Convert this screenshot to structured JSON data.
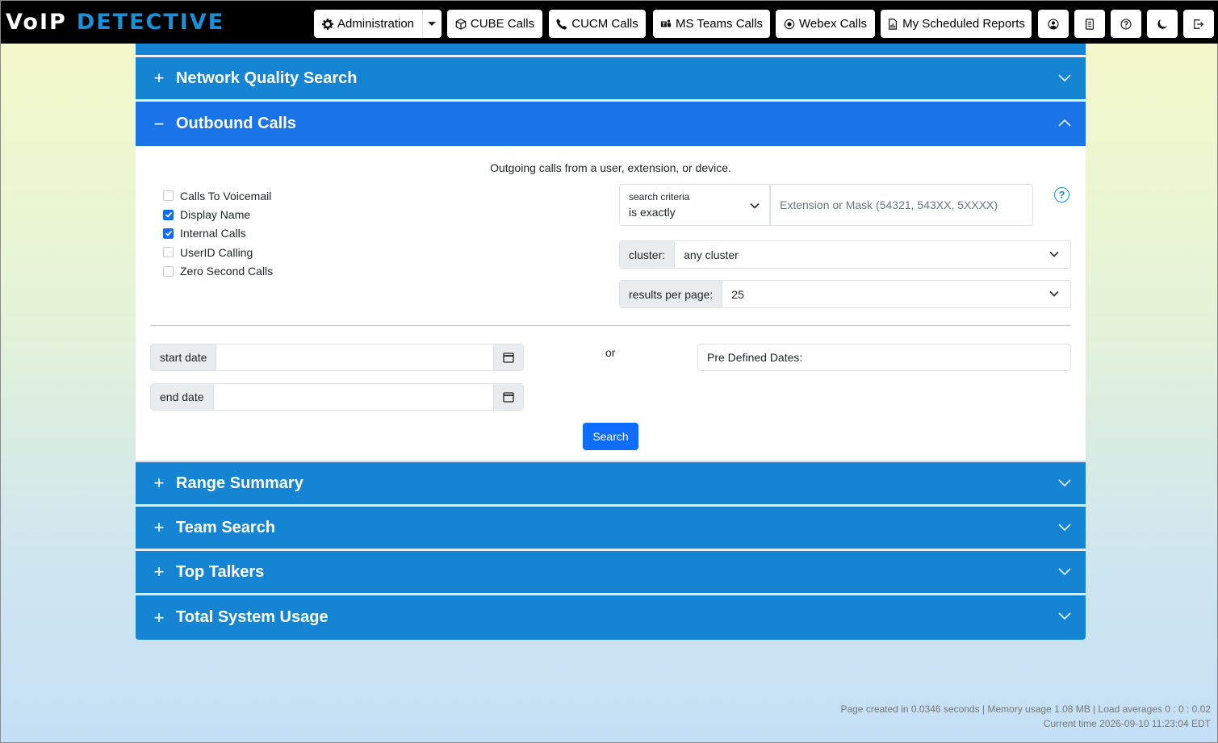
{
  "logo": {
    "voip": "VoIP",
    "detective": "DETECTIVE"
  },
  "nav": {
    "administration": "Administration",
    "cube": "CUBE Calls",
    "cucm": "CUCM Calls",
    "msteams": "MS Teams Calls",
    "webex": "Webex Calls",
    "reports": "My Scheduled Reports"
  },
  "accordion": {
    "network_quality": "Network Quality Search",
    "outbound": "Outbound Calls",
    "range_summary": "Range Summary",
    "team_search": "Team Search",
    "top_talkers": "Top Talkers",
    "total_usage": "Total System Usage",
    "plus": "+",
    "minus": "−"
  },
  "outbound": {
    "intro": "Outgoing calls from a user, extension, or device.",
    "checkboxes": [
      {
        "label": "Calls To Voicemail",
        "checked": false
      },
      {
        "label": "Display Name",
        "checked": true
      },
      {
        "label": "Internal Calls",
        "checked": true
      },
      {
        "label": "UserID Calling",
        "checked": false
      },
      {
        "label": "Zero Second Calls",
        "checked": false
      }
    ],
    "criteria_label": "search criteria",
    "criteria_value": "is exactly",
    "extension_placeholder": "Extension or Mask (54321, 543XX, 5XXXX)",
    "help": "?",
    "cluster_label": "cluster:",
    "cluster_value": "any cluster",
    "rpp_label": "results per page:",
    "rpp_value": "25",
    "start_label": "start date",
    "end_label": "end date",
    "or": "or",
    "predefined": "Pre Defined Dates:",
    "search": "Search"
  },
  "footer": {
    "line1": "Page created in 0.0346 seconds | Memory usage 1.08 MB | Load averages 0 : 0 : 0.02",
    "line2": "Current time 2026-09-10 11:23:04 EDT"
  }
}
